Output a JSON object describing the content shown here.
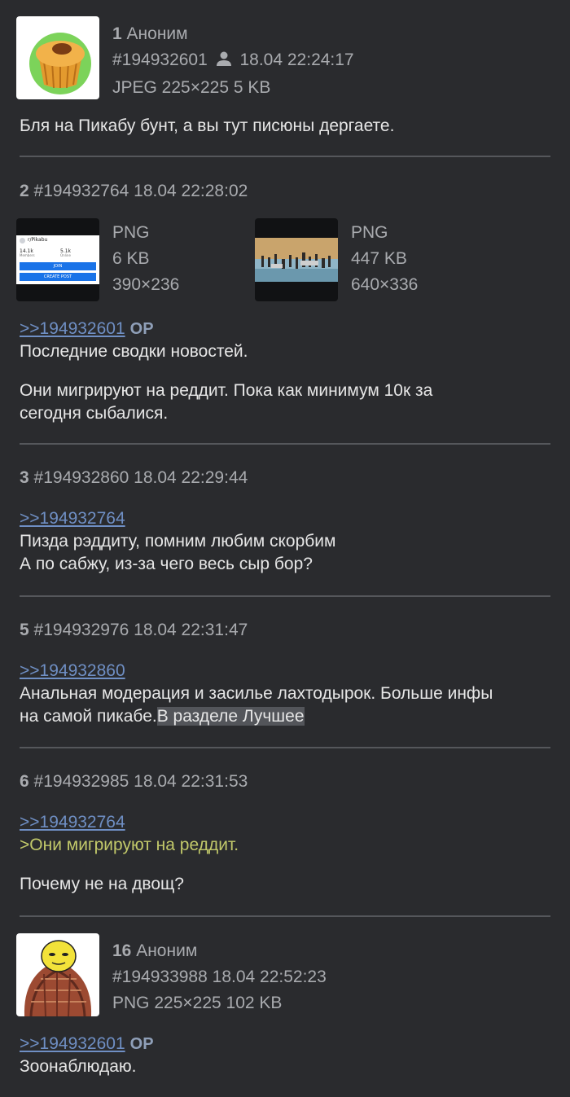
{
  "posts": {
    "p1": {
      "num": "1",
      "author": "Аноним",
      "id": "#194932601",
      "user_icon": "person-icon",
      "date": "18.04 22:24:17",
      "file": "JPEG 225×225 5 KB",
      "text": "Бля на Пикабу бунт, а вы тут писюны дергаете."
    },
    "p2": {
      "num": "2",
      "id": "#194932764",
      "date": "18.04 22:28:02",
      "files": [
        {
          "type": "PNG",
          "size": "6 KB",
          "dims": "390×236",
          "thumb": {
            "sub": "r/Pikabu",
            "members": "14.1k",
            "members_label": "Members",
            "online": "5.1k",
            "online_label": "Online",
            "join": "JOIN",
            "create": "CREATE POST"
          }
        },
        {
          "type": "PNG",
          "size": "447 KB",
          "dims": "640×336"
        }
      ],
      "reply_link": ">>194932601",
      "op": "OP",
      "line1": "Последние сводки новостей.",
      "line2": "Они мигрируют на реддит. Пока как минимум 10к за",
      "line3": "сегодня сыбалися."
    },
    "p3": {
      "num": "3",
      "id": "#194932860",
      "date": "18.04 22:29:44",
      "reply_link": ">>194932764",
      "line1": "Пизда рэддиту, помним любим скорбим",
      "line2": "А по сабжу, из-за чего весь сыр бор?"
    },
    "p5": {
      "num": "5",
      "id": "#194932976",
      "date": "18.04 22:31:47",
      "reply_link": ">>194932860",
      "line1": "Анальная модерация и засилье лахтодырок. Больше инфы",
      "line2": "на самой пикабе.",
      "selected": "В разделе Лучшее"
    },
    "p6": {
      "num": "6",
      "id": "#194932985",
      "date": "18.04 22:31:53",
      "reply_link": ">>194932764",
      "quote": ">Они мигрируют на реддит.",
      "line1": "Почему не на двощ?"
    },
    "p16": {
      "num": "16",
      "author": "Аноним",
      "id": "#194933988",
      "date": "18.04 22:52:23",
      "file": "PNG 225×225 102 KB",
      "reply_link": ">>194932601",
      "op": "OP",
      "line1": "Зоонаблюдаю."
    }
  }
}
